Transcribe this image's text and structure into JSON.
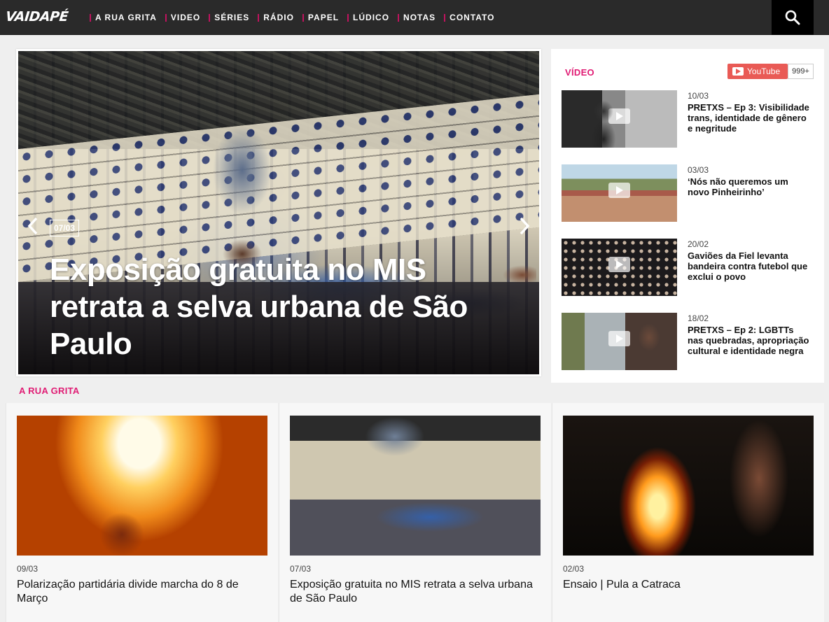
{
  "nav": {
    "logo": "VAIDAPÉ",
    "items": [
      "A RUA GRITA",
      "VIDEO",
      "SÉRIES",
      "RÁDIO",
      "PAPEL",
      "LÚDICO",
      "NOTAS",
      "CONTATO"
    ]
  },
  "hero": {
    "date": "07/03",
    "title": "Exposição gratuita no MIS retrata a selva urbana de São Paulo"
  },
  "video": {
    "title": "VÍDEO",
    "youtube_label": "YouTube",
    "subscriber_count": "999+",
    "items": [
      {
        "date": "10/03",
        "title": "PRETXS – Ep 3: Visibilidade trans, identidade de gênero e negritude"
      },
      {
        "date": "03/03",
        "title": "‘Nós não queremos um novo Pinheirinho’"
      },
      {
        "date": "20/02",
        "title": "Gaviões da Fiel levanta bandeira contra futebol que exclui o povo"
      },
      {
        "date": "18/02",
        "title": "PRETXS – Ep 2: LGBTTs nas quebradas, apropriação cultural e identidade negra"
      }
    ]
  },
  "section": {
    "title": "A RUA GRITA",
    "cards": [
      {
        "date": "09/03",
        "title": "Polarização partidária divide marcha do 8 de Março"
      },
      {
        "date": "07/03",
        "title": "Exposição gratuita no MIS retrata a selva urbana de São Paulo"
      },
      {
        "date": "02/03",
        "title": "Ensaio | Pula a Catraca"
      }
    ]
  },
  "colors": {
    "accent": "#e01c74",
    "nav_bg": "#2a2a2a",
    "youtube": "#e95a55"
  }
}
